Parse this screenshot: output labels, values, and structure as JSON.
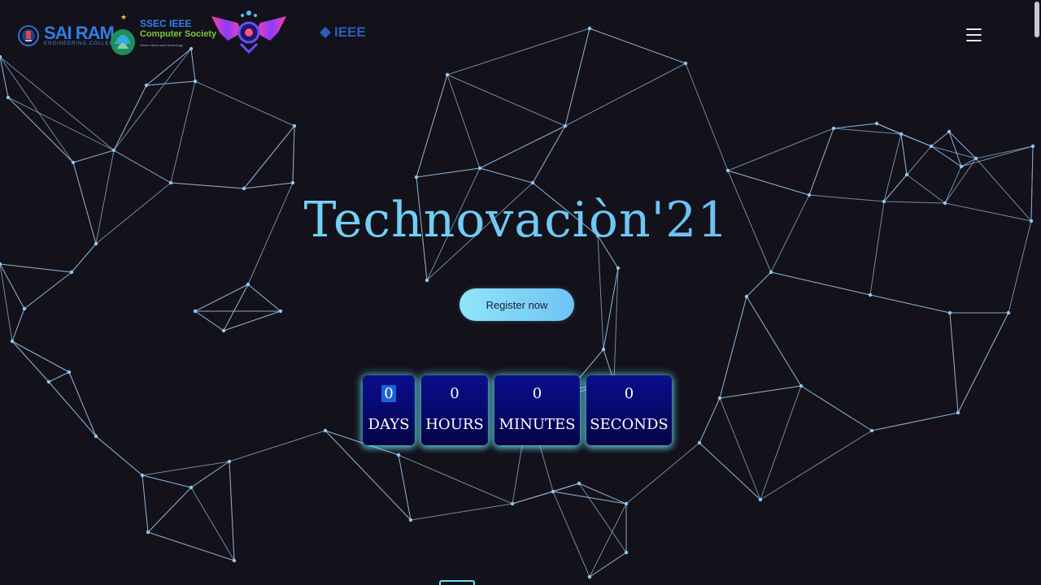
{
  "header": {
    "logos": {
      "sairam": {
        "main": "SAI RAM",
        "sub": "ENGINEERING COLLEGE"
      },
      "ssec": {
        "line1": "SSEC IEEE",
        "line2": "Computer Society",
        "line3": "Where ideas meet technology"
      },
      "ieee": {
        "label": "IEEE"
      }
    },
    "menu_icon": "hamburger-menu-icon"
  },
  "hero": {
    "title": "Technovaciòn'21",
    "register_label": "Register now"
  },
  "countdown": {
    "units": [
      {
        "value": "0",
        "label": "DAYS"
      },
      {
        "value": "0",
        "label": "HOURS"
      },
      {
        "value": "0",
        "label": "MINUTES"
      },
      {
        "value": "0",
        "label": "SECONDS"
      }
    ]
  },
  "colors": {
    "background": "#13111a",
    "title_gradient_start": "#74e0f6",
    "title_gradient_end": "#6aa9f0",
    "countdown_box": "#08096e",
    "countdown_glow": "#6eebff",
    "network_line": "#8fb4d6"
  }
}
